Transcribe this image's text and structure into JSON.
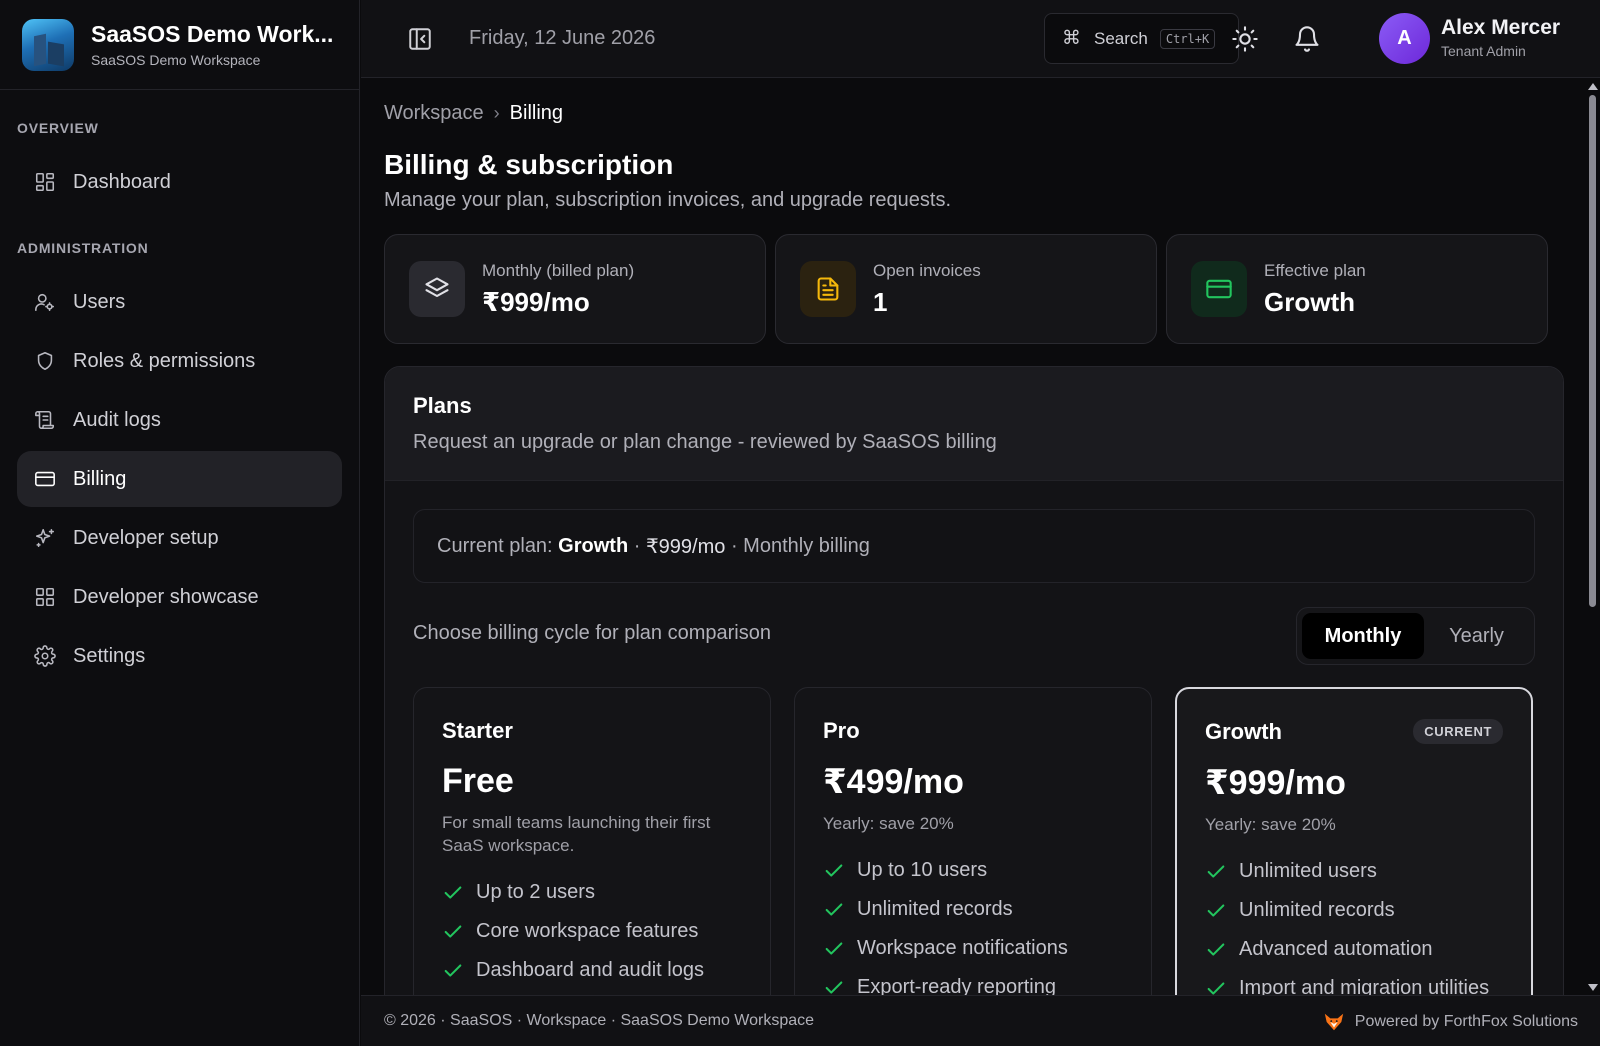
{
  "brand": {
    "title": "SaaSOS Demo Work...",
    "subtitle": "SaaSOS Demo Workspace"
  },
  "sidebar": {
    "overview_heading": "OVERVIEW",
    "admin_heading": "ADMINISTRATION",
    "items": [
      {
        "label": "Dashboard",
        "icon": "dashboard-icon"
      },
      {
        "label": "Users",
        "icon": "users-icon"
      },
      {
        "label": "Roles & permissions",
        "icon": "shield-icon"
      },
      {
        "label": "Audit logs",
        "icon": "scroll-icon"
      },
      {
        "label": "Billing",
        "icon": "credit-card-icon",
        "active": true
      },
      {
        "label": "Developer setup",
        "icon": "sparkles-icon"
      },
      {
        "label": "Developer showcase",
        "icon": "grid-icon"
      },
      {
        "label": "Settings",
        "icon": "gear-icon"
      }
    ]
  },
  "topbar": {
    "date": "Friday, 12 June 2026",
    "search_label": "Search",
    "search_shortcut": "Ctrl+K",
    "user": {
      "initial": "A",
      "name": "Alex Mercer",
      "role": "Tenant Admin"
    }
  },
  "breadcrumb": {
    "parent": "Workspace",
    "current": "Billing"
  },
  "page": {
    "title": "Billing & subscription",
    "subtitle": "Manage your plan, subscription invoices, and upgrade requests."
  },
  "stats": [
    {
      "label": "Monthly (billed plan)",
      "value": "₹999/mo",
      "icon": "layers-icon",
      "color": "#2a2a30"
    },
    {
      "label": "Open invoices",
      "value": "1",
      "icon": "invoice-icon",
      "color": "#f5b80b"
    },
    {
      "label": "Effective plan",
      "value": "Growth",
      "icon": "credit-card-icon",
      "color": "#22c55e"
    }
  ],
  "plans": {
    "title": "Plans",
    "description": "Request an upgrade or plan change - reviewed by SaaSOS billing",
    "current_prefix": "Current plan: ",
    "current_name": "Growth",
    "current_sep1": " · ",
    "current_price": "₹999/mo",
    "current_sep2": " · Monthly billing",
    "cycle_label": "Choose billing cycle for plan comparison",
    "cycle_monthly": "Monthly",
    "cycle_yearly": "Yearly",
    "cards": [
      {
        "name": "Starter",
        "price": "Free",
        "note": "For small teams launching their first SaaS workspace.",
        "features": [
          "Up to 2 users",
          "Core workspace features",
          "Dashboard and audit logs"
        ]
      },
      {
        "name": "Pro",
        "price": "₹499/mo",
        "note": "Yearly: save 20%",
        "features": [
          "Up to 10 users",
          "Unlimited records",
          "Workspace notifications",
          "Export-ready reporting"
        ]
      },
      {
        "name": "Growth",
        "price": "₹999/mo",
        "note": "Yearly: save 20%",
        "badge": "CURRENT",
        "features": [
          "Unlimited users",
          "Unlimited records",
          "Advanced automation",
          "Import and migration utilities"
        ]
      }
    ]
  },
  "footer": {
    "left": "© 2026 · SaaSOS · Workspace · SaaSOS Demo Workspace",
    "right": "Powered by ForthFox Solutions"
  },
  "colors": {
    "accent_green": "#22c55e",
    "accent_amber": "#f5b80b",
    "avatar_purple": "#7c3aed"
  }
}
